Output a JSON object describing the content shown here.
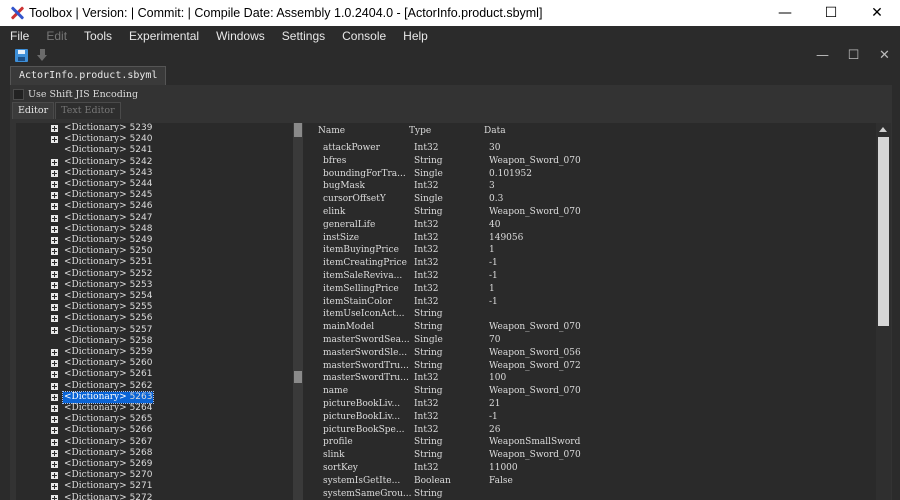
{
  "window": {
    "title": "Toolbox | Version:  | Commit:  | Compile Date:  Assembly 1.0.2404.0 - [ActorInfo.product.sbyml]",
    "min_glyph": "—",
    "max_glyph": "☐",
    "close_glyph": "✕"
  },
  "menu": {
    "items": [
      {
        "label": "File",
        "enabled": true
      },
      {
        "label": "Edit",
        "enabled": false
      },
      {
        "label": "Tools",
        "enabled": true
      },
      {
        "label": "Experimental",
        "enabled": true
      },
      {
        "label": "Windows",
        "enabled": true
      },
      {
        "label": "Settings",
        "enabled": true
      },
      {
        "label": "Console",
        "enabled": true
      },
      {
        "label": "Help",
        "enabled": true
      }
    ]
  },
  "toolbar": {
    "icons": [
      "save-icon",
      "download-icon"
    ]
  },
  "mdi": {
    "min_glyph": "—",
    "max_glyph": "☐",
    "close_glyph": "✕"
  },
  "document": {
    "tab_label": "ActorInfo.product.sbyml",
    "shift_jis_label": "Use Shift JIS Encoding",
    "shift_jis_checked": false,
    "editor_tab": "Editor",
    "text_editor_tab": "Text Editor"
  },
  "tree": {
    "node_label": "<Dictionary>",
    "selected_index": 24,
    "items": [
      {
        "number": "5239",
        "expandable": true
      },
      {
        "number": "5240",
        "expandable": true
      },
      {
        "number": "5241",
        "expandable": false
      },
      {
        "number": "5242",
        "expandable": true
      },
      {
        "number": "5243",
        "expandable": true
      },
      {
        "number": "5244",
        "expandable": true
      },
      {
        "number": "5245",
        "expandable": true
      },
      {
        "number": "5246",
        "expandable": true
      },
      {
        "number": "5247",
        "expandable": true
      },
      {
        "number": "5248",
        "expandable": true
      },
      {
        "number": "5249",
        "expandable": true
      },
      {
        "number": "5250",
        "expandable": true
      },
      {
        "number": "5251",
        "expandable": true
      },
      {
        "number": "5252",
        "expandable": true
      },
      {
        "number": "5253",
        "expandable": true
      },
      {
        "number": "5254",
        "expandable": true
      },
      {
        "number": "5255",
        "expandable": true
      },
      {
        "number": "5256",
        "expandable": true
      },
      {
        "number": "5257",
        "expandable": true
      },
      {
        "number": "5258",
        "expandable": false
      },
      {
        "number": "5259",
        "expandable": true
      },
      {
        "number": "5260",
        "expandable": true
      },
      {
        "number": "5261",
        "expandable": true
      },
      {
        "number": "5262",
        "expandable": true
      },
      {
        "number": "5263",
        "expandable": true
      },
      {
        "number": "5264",
        "expandable": true
      },
      {
        "number": "5265",
        "expandable": true
      },
      {
        "number": "5266",
        "expandable": true
      },
      {
        "number": "5267",
        "expandable": true
      },
      {
        "number": "5268",
        "expandable": true
      },
      {
        "number": "5269",
        "expandable": true
      },
      {
        "number": "5270",
        "expandable": true
      },
      {
        "number": "5271",
        "expandable": true
      },
      {
        "number": "5272",
        "expandable": true
      }
    ]
  },
  "grid": {
    "columns": [
      "Name",
      "Type",
      "Data"
    ],
    "rows": [
      [
        "attackPower",
        "Int32",
        "30"
      ],
      [
        "bfres",
        "String",
        "Weapon_Sword_070"
      ],
      [
        "boundingForTra...",
        "Single",
        "0.101952"
      ],
      [
        "bugMask",
        "Int32",
        "3"
      ],
      [
        "cursorOffsetY",
        "Single",
        "0.3"
      ],
      [
        "elink",
        "String",
        "Weapon_Sword_070"
      ],
      [
        "generalLife",
        "Int32",
        "40"
      ],
      [
        "instSize",
        "Int32",
        "149056"
      ],
      [
        "itemBuyingPrice",
        "Int32",
        "1"
      ],
      [
        "itemCreatingPrice",
        "Int32",
        "-1"
      ],
      [
        "itemSaleReviva...",
        "Int32",
        "-1"
      ],
      [
        "itemSellingPrice",
        "Int32",
        "1"
      ],
      [
        "itemStainColor",
        "Int32",
        "-1"
      ],
      [
        "itemUseIconAct...",
        "String",
        ""
      ],
      [
        "mainModel",
        "String",
        "Weapon_Sword_070"
      ],
      [
        "masterSwordSea...",
        "Single",
        "70"
      ],
      [
        "masterSwordSle...",
        "String",
        "Weapon_Sword_056"
      ],
      [
        "masterSwordTru...",
        "String",
        "Weapon_Sword_072"
      ],
      [
        "masterSwordTru...",
        "Int32",
        "100"
      ],
      [
        "name",
        "String",
        "Weapon_Sword_070"
      ],
      [
        "pictureBookLiv...",
        "Int32",
        "21"
      ],
      [
        "pictureBookLiv...",
        "Int32",
        "-1"
      ],
      [
        "pictureBookSpe...",
        "Int32",
        "26"
      ],
      [
        "profile",
        "String",
        "WeaponSmallSword"
      ],
      [
        "slink",
        "String",
        "Weapon_Sword_070"
      ],
      [
        "sortKey",
        "Int32",
        "11000"
      ],
      [
        "systemIsGetIte...",
        "Boolean",
        "False"
      ],
      [
        "systemSameGrou...",
        "String",
        ""
      ]
    ]
  }
}
